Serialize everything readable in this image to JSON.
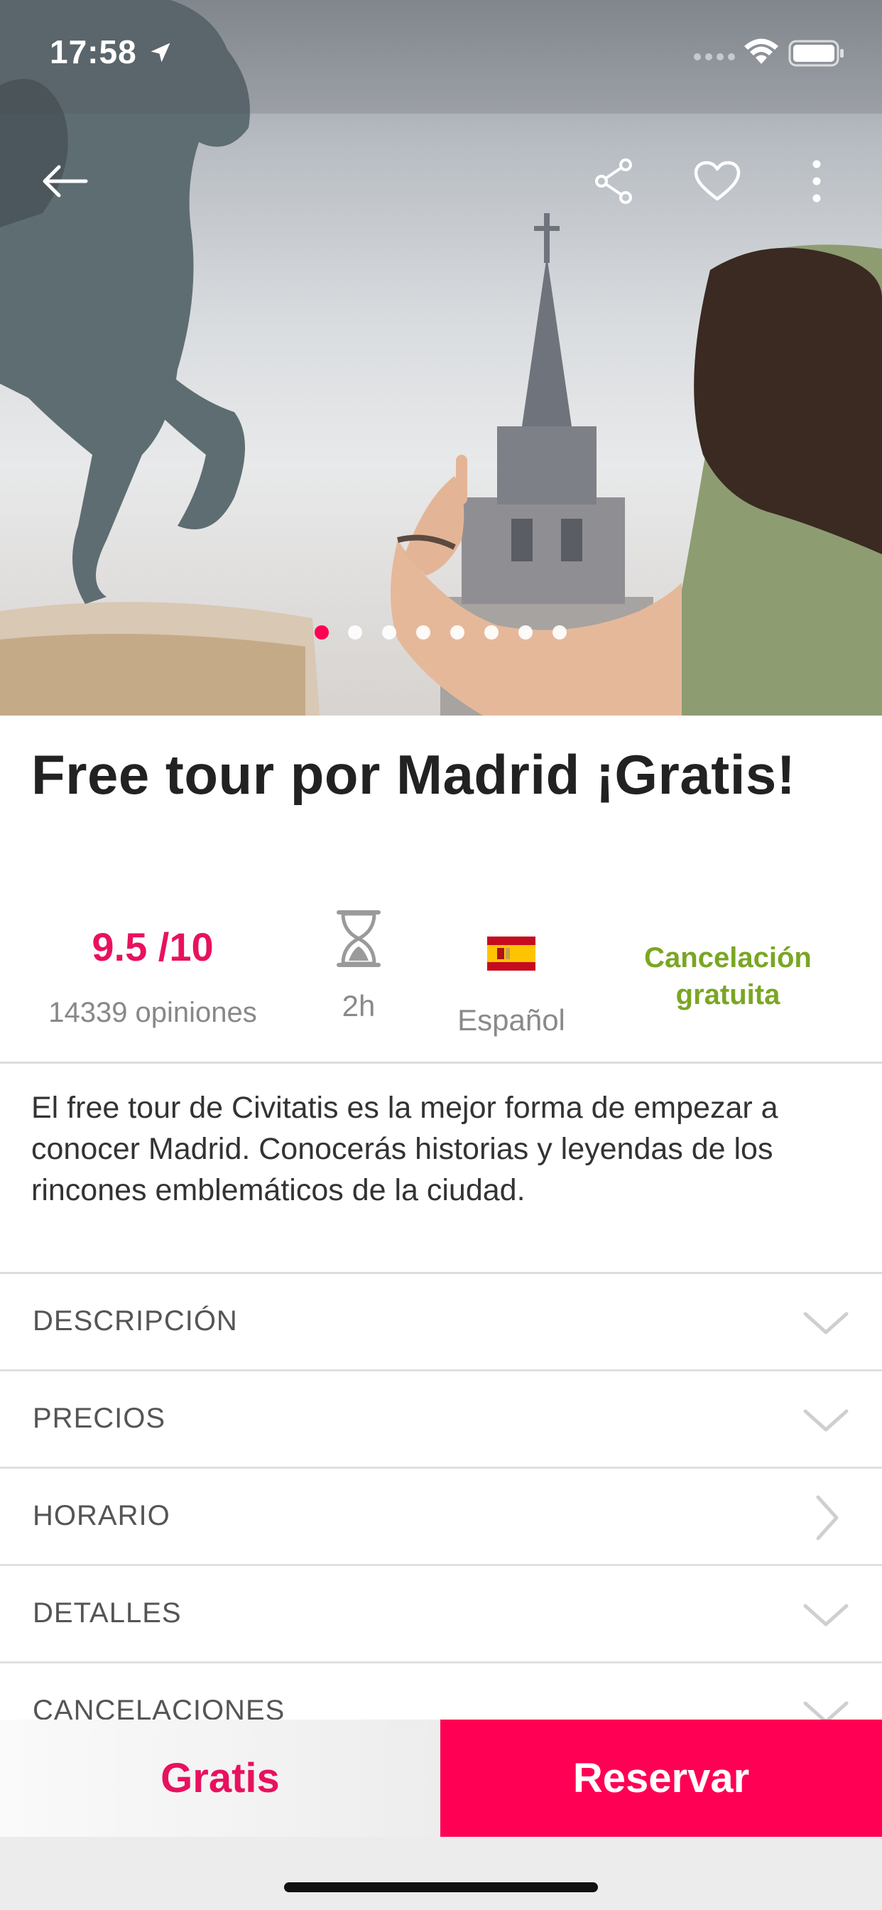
{
  "status_bar": {
    "time": "17:58"
  },
  "hero": {
    "icons": {
      "back": "arrow-left-icon",
      "share": "share-icon",
      "favorite": "heart-outline-icon",
      "more": "more-vertical-icon"
    },
    "carousel": {
      "count": 8,
      "active_index": 0
    }
  },
  "activity": {
    "title": "Free tour por Madrid ¡Gratis!",
    "rating": "9.5 /10",
    "reviews": "14339 opiniones",
    "duration": "2h",
    "language": "Español",
    "cancellation": "Cancelación gratuita",
    "summary": "El free tour de Civitatis es la mejor forma de empezar a conocer Madrid. Conocerás historias y leyendas de los rincones emblemáticos de la ciudad."
  },
  "sections": [
    {
      "label": "DESCRIPCIÓN",
      "icon": "chevron-down-icon"
    },
    {
      "label": "PRECIOS",
      "icon": "chevron-down-icon"
    },
    {
      "label": "HORARIO",
      "icon": "chevron-right-icon"
    },
    {
      "label": "DETALLES",
      "icon": "chevron-down-icon"
    },
    {
      "label": "CANCELACIONES",
      "icon": "chevron-down-icon"
    }
  ],
  "bottom_bar": {
    "price": "Gratis",
    "book_label": "Reservar"
  },
  "colors": {
    "accent": "#ff0055",
    "rating": "#e8115f",
    "free_cancel": "#7aa623"
  }
}
